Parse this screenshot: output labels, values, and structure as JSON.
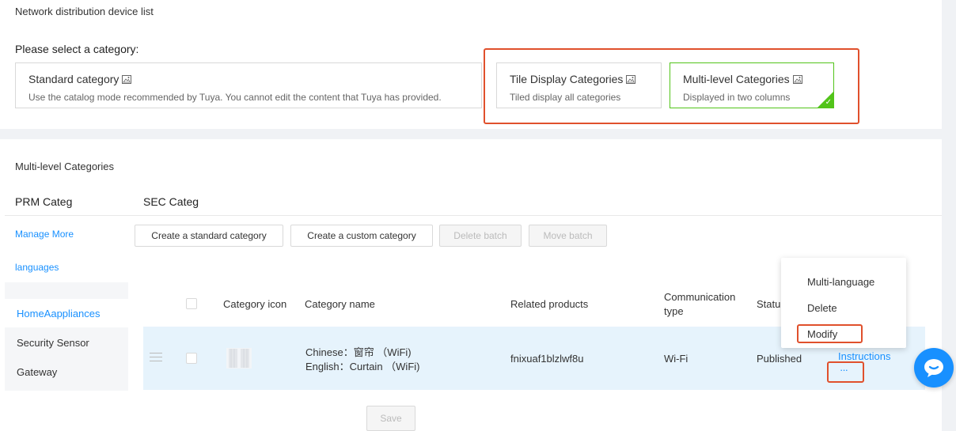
{
  "top": {
    "list_title": "Network distribution device list",
    "select_label": "Please select a category:",
    "cards": [
      {
        "title": "Standard category",
        "desc": "Use the catalog mode recommended by Tuya. You cannot edit the content that Tuya has provided."
      },
      {
        "title": "Tile Display Categories",
        "desc": "Tiled display all categories"
      },
      {
        "title": "Multi-level Categories",
        "desc": "Displayed in two columns"
      }
    ]
  },
  "section": {
    "title": "Multi-level Categories",
    "prm_label": "PRM Categ",
    "sec_label": "SEC Categ",
    "manage_link_1": "Manage More",
    "manage_link_2": "languages"
  },
  "toolbar": {
    "create_standard": "Create a standard category",
    "create_custom": "Create a custom category",
    "delete_batch": "Delete batch",
    "move_batch": "Move batch"
  },
  "sidebar": {
    "items": [
      "HomeAappliances",
      "Security Sensor",
      "Gateway"
    ]
  },
  "table": {
    "headers": {
      "icon": "Category icon",
      "name": "Category name",
      "products": "Related products",
      "comm_1": "Communication",
      "comm_2": "type",
      "status": "Statu"
    },
    "rows": [
      {
        "name_cn": "Chinese：窗帘 （WiFi)",
        "name_en": "English：Curtain （WiFi)",
        "products": "fnixuaf1blzlwf8u",
        "comm": "Wi-Fi",
        "status": "Published",
        "instructions": "Instructions",
        "more": "···"
      }
    ]
  },
  "menu": {
    "items": [
      "Multi-language",
      "Delete",
      "Modify"
    ]
  },
  "footer": {
    "save": "Save"
  },
  "colors": {
    "accent": "#1890ff",
    "selected": "#52c41a",
    "highlight": "#e0502c"
  }
}
